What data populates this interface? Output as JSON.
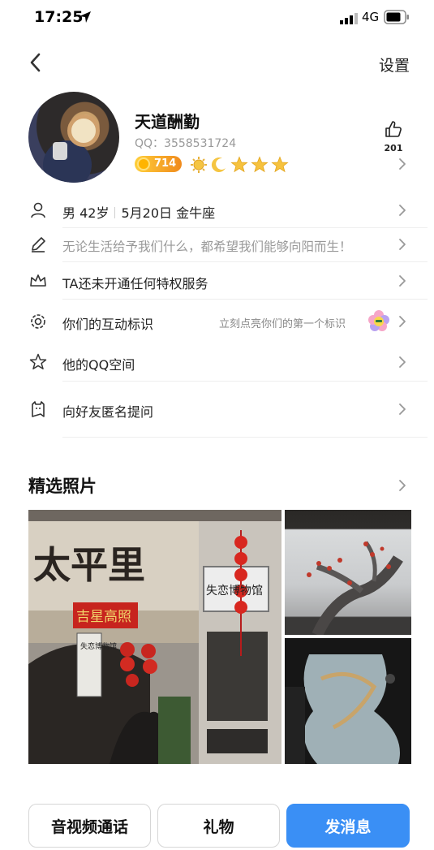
{
  "status_bar": {
    "time": "17:25",
    "network": "4G"
  },
  "nav": {
    "settings_label": "设置"
  },
  "profile": {
    "nickname": "天道酬勤",
    "qq_number": "QQ：3558531724",
    "level_value": "714",
    "like_count": "201"
  },
  "info_rows": {
    "basic": {
      "gender_age": "男 42岁",
      "birthday": "5月20日 金牛座"
    },
    "signature": "无论生活给予我们什么，都希望我们能够向阳而生！",
    "privilege": "TA还未开通任何特权服务",
    "interaction": {
      "label": "你们的互动标识",
      "hint": "立刻点亮你们的第一个标识"
    },
    "qzone": "他的QQ空间",
    "anonymous": "向好友匿名提问"
  },
  "photos": {
    "title": "精选照片",
    "sign_big": "太平里",
    "sign_red": "吉星高照",
    "sign_white": "失恋博物馆",
    "sign_small": "失恋博物馆"
  },
  "bottom_actions": {
    "av_call": "音视频通话",
    "gift": "礼物",
    "message": "发消息"
  },
  "colors": {
    "accent": "#3a8ff5",
    "level_badge": "#f08a1c"
  },
  "icons": [
    "location-arrow-icon",
    "signal-icon",
    "battery-icon",
    "back-icon",
    "thumbs-up-icon",
    "chevron-right-icon",
    "person-icon",
    "pen-icon",
    "crown-icon",
    "gear-icon",
    "star-icon",
    "ghost-icon"
  ]
}
